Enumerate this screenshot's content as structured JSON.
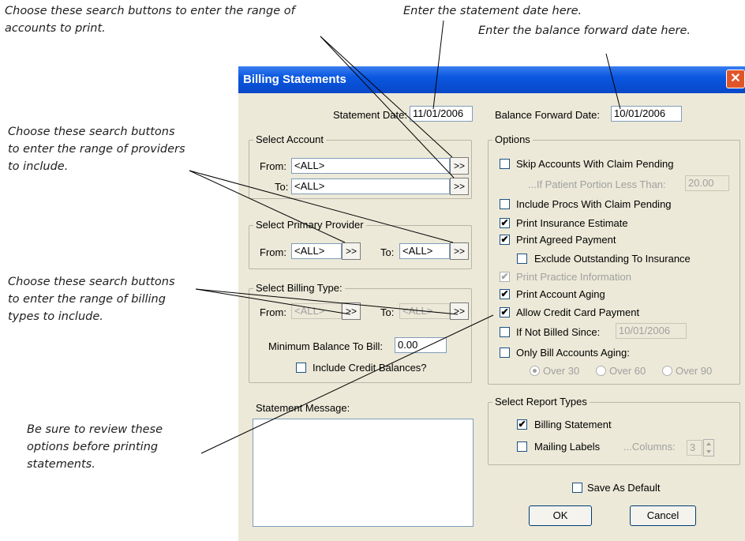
{
  "callouts": {
    "search_accounts": "Choose these search buttons to enter the range of\naccounts to print.",
    "statement_date": "Enter the statement date here.",
    "balance_forward": "Enter the balance forward date here.",
    "providers": "Choose these search buttons\nto enter the range of providers\nto include.",
    "billing_types": "Choose these search buttons\nto enter the range of billing\ntypes to include.",
    "review_options": "Be sure to review these\noptions before printing\nstatements."
  },
  "dialog": {
    "title": "Billing Statements",
    "close_glyph": "✕",
    "statement_date_label": "Statement Date:",
    "statement_date": "11/01/2006",
    "balance_forward_label": "Balance Forward Date:",
    "balance_forward_date": "10/01/2006",
    "search_button": ">>",
    "select_account": {
      "title": "Select Account",
      "from_label": "From:",
      "from_value": "<ALL>",
      "to_label": "To:",
      "to_value": "<ALL>"
    },
    "select_provider": {
      "title": "Select Primary Provider",
      "from_label": "From:",
      "from_value": "<ALL>",
      "to_label": "To:",
      "to_value": "<ALL>"
    },
    "select_billing_type": {
      "title": "Select Billing Type:",
      "from_label": "From:",
      "from_value": "<ALL>",
      "to_label": "To:",
      "to_value": "<ALL>",
      "min_balance_label": "Minimum Balance To Bill:",
      "min_balance_value": "0.00",
      "include_credit_label": "Include Credit Balances?"
    },
    "statement_message_label": "Statement Message:",
    "options": {
      "title": "Options",
      "skip_claim_pending": "Skip Accounts With Claim Pending",
      "patient_portion_label": "...If Patient Portion Less Than:",
      "patient_portion_value": "20.00",
      "include_procs": "Include Procs With Claim Pending",
      "print_insurance_estimate": "Print Insurance Estimate",
      "print_agreed_payment": "Print Agreed Payment",
      "exclude_outstanding": "Exclude Outstanding To Insurance",
      "print_practice_info": "Print Practice Information",
      "print_account_aging": "Print Account Aging",
      "allow_credit_card": "Allow Credit Card Payment",
      "if_not_billed": "If Not Billed Since:",
      "if_not_billed_value": "10/01/2006",
      "only_bill_aging": "Only Bill Accounts Aging:",
      "over30": "Over 30",
      "over60": "Over 60",
      "over90": "Over 90"
    },
    "report_types": {
      "title": "Select Report Types",
      "billing_statement": "Billing Statement",
      "mailing_labels": "Mailing Labels",
      "columns_label": "...Columns:",
      "columns_value": "3"
    },
    "save_default": "Save As Default",
    "ok": "OK",
    "cancel": "Cancel",
    "check_glyph": "✔"
  }
}
